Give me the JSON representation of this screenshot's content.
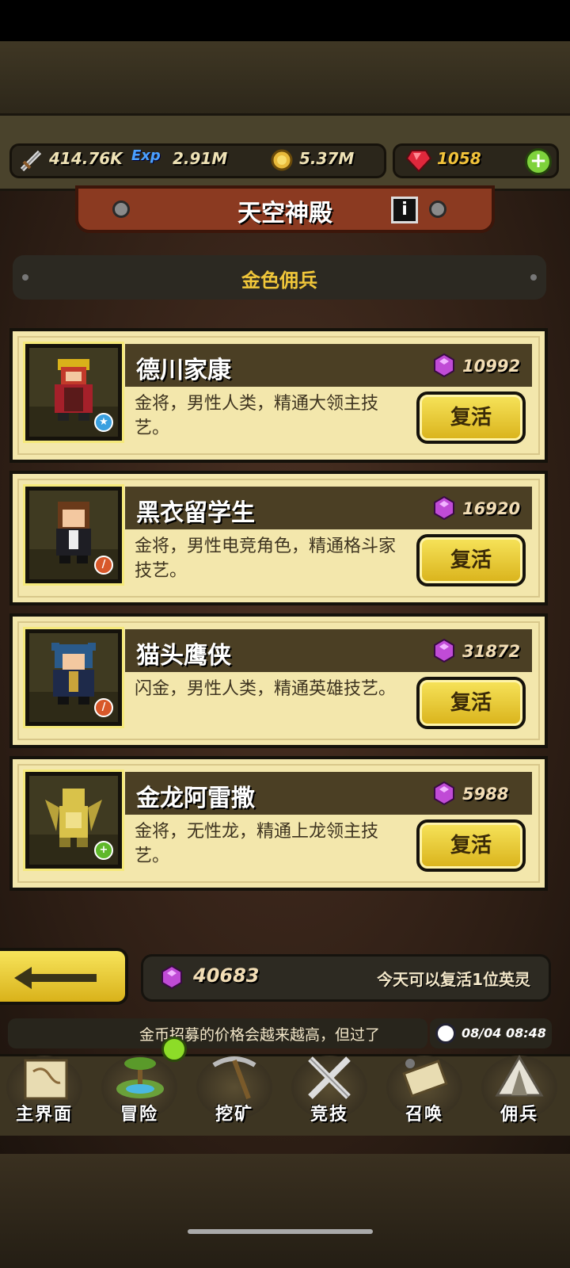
{
  "currency": {
    "attack": "414.76K",
    "exp": "2.91M",
    "gold": "5.37M",
    "gems": "1058",
    "exp_icon_label": "Exp"
  },
  "header": {
    "title": "天空神殿",
    "info_label": "i",
    "subtitle": "金色佣兵"
  },
  "heroes": [
    {
      "name": "德川家康",
      "price": "10992",
      "desc": "金将，男性人类，精通大领主技艺。",
      "revive_label": "复活",
      "badge_icon": "star-icon"
    },
    {
      "name": "黑衣留学生",
      "price": "16920",
      "desc": "金将，男性电竞角色，精通格斗家技艺。",
      "revive_label": "复活",
      "badge_icon": "sword-icon"
    },
    {
      "name": "猫头鹰侠",
      "price": "31872",
      "desc": "闪金，男性人类，精通英雄技艺。",
      "revive_label": "复活",
      "badge_icon": "sword-icon"
    },
    {
      "name": "金龙阿雷撒",
      "price": "5988",
      "desc": "金将，无性龙，精通上龙领主技艺。",
      "revive_label": "复活",
      "badge_icon": "plus-icon"
    }
  ],
  "footer": {
    "gem_total": "40683",
    "revive_note": "今天可以复活1位英灵",
    "ticker": "金币招募的价格会越来越高，但过了",
    "clock": "08/04 08:48"
  },
  "nav": [
    {
      "label": "主界面",
      "icon": "map-scroll-icon"
    },
    {
      "label": "冒险",
      "icon": "island-icon"
    },
    {
      "label": "挖矿",
      "icon": "pickaxe-icon"
    },
    {
      "label": "竞技",
      "icon": "crossed-swords-icon"
    },
    {
      "label": "召唤",
      "icon": "scroll-icon"
    },
    {
      "label": "佣兵",
      "icon": "tent-icon"
    }
  ],
  "colors": {
    "accent_gold": "#f0c63a",
    "card_bg": "#f3e7ac",
    "banner": "#8b3a21",
    "gem_purple": "#c04bd6"
  }
}
